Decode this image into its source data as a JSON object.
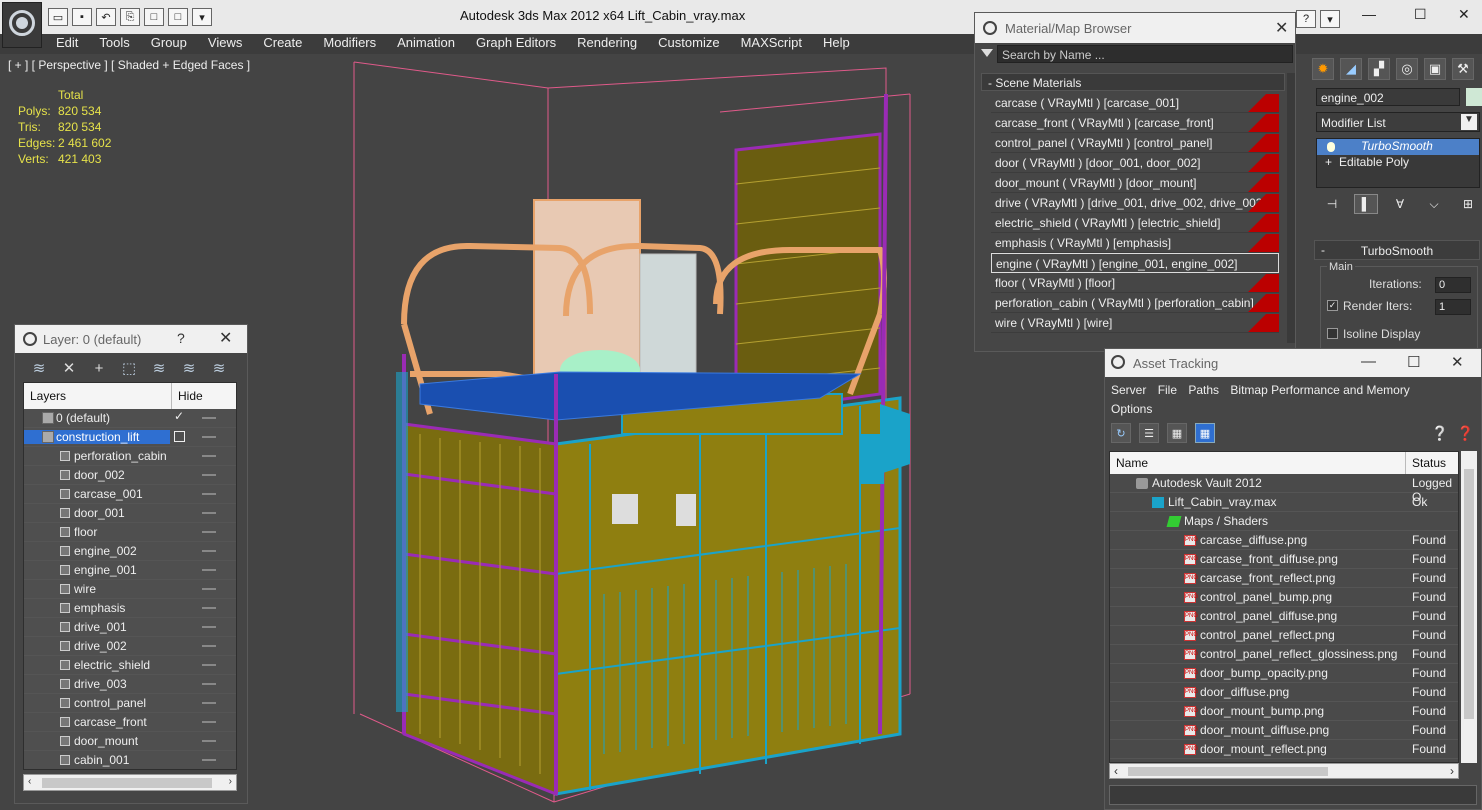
{
  "app": {
    "title": "Autodesk 3ds Max  2012 x64      Lift_Cabin_vray.max"
  },
  "menu": [
    "Edit",
    "Tools",
    "Group",
    "Views",
    "Create",
    "Modifiers",
    "Animation",
    "Graph Editors",
    "Rendering",
    "Customize",
    "MAXScript",
    "Help"
  ],
  "viewport": {
    "label": "[ + ] [ Perspective ] [ Shaded + Edged Faces ]",
    "stats": {
      "header": "Total",
      "rows": [
        {
          "k": "Polys:",
          "v": "820 534"
        },
        {
          "k": "Tris:",
          "v": "820 534"
        },
        {
          "k": "Edges:",
          "v": "2 461 602"
        },
        {
          "k": "Verts:",
          "v": "421 403"
        }
      ]
    }
  },
  "layer_panel": {
    "title": "Layer: 0 (default)",
    "help": "?",
    "col_layers": "Layers",
    "col_hide": "Hide",
    "rows": [
      {
        "name": "0 (default)",
        "level": 0
      },
      {
        "name": "construction_lift",
        "level": 0
      },
      {
        "name": "perforation_cabin",
        "level": 1
      },
      {
        "name": "door_002",
        "level": 1
      },
      {
        "name": "carcase_001",
        "level": 1
      },
      {
        "name": "door_001",
        "level": 1
      },
      {
        "name": "floor",
        "level": 1
      },
      {
        "name": "engine_002",
        "level": 1
      },
      {
        "name": "engine_001",
        "level": 1
      },
      {
        "name": "wire",
        "level": 1
      },
      {
        "name": "emphasis",
        "level": 1
      },
      {
        "name": "drive_001",
        "level": 1
      },
      {
        "name": "drive_002",
        "level": 1
      },
      {
        "name": "electric_shield",
        "level": 1
      },
      {
        "name": "drive_003",
        "level": 1
      },
      {
        "name": "control_panel",
        "level": 1
      },
      {
        "name": "carcase_front",
        "level": 1
      },
      {
        "name": "door_mount",
        "level": 1
      },
      {
        "name": "cabin_001",
        "level": 1
      }
    ]
  },
  "material_browser": {
    "title": "Material/Map Browser",
    "search_placeholder": "Search by Name ...",
    "section": "- Scene Materials",
    "materials": [
      "carcase  ( VRayMtl ) [carcase_001]",
      "carcase_front  ( VRayMtl ) [carcase_front]",
      "control_panel  ( VRayMtl ) [control_panel]",
      "door  ( VRayMtl ) [door_001, door_002]",
      "door_mount  ( VRayMtl ) [door_mount]",
      "drive  ( VRayMtl ) [drive_001, drive_002, drive_003]",
      "electric_shield  ( VRayMtl ) [electric_shield]",
      "emphasis  ( VRayMtl ) [emphasis]",
      "engine  ( VRayMtl ) [engine_001, engine_002]",
      "floor  ( VRayMtl ) [floor]",
      "perforation_cabin  ( VRayMtl ) [perforation_cabin]",
      "wire  ( VRayMtl ) [wire]"
    ],
    "selected_index": 8
  },
  "command_panel": {
    "object_name": "engine_002",
    "modifier_list": "Modifier List",
    "stack": [
      "TurboSmooth",
      "Editable Poly"
    ],
    "rollout": "TurboSmooth",
    "main_label": "Main",
    "iterations_label": "Iterations:",
    "iterations_value": "0",
    "render_iters_label": "Render Iters:",
    "render_iters_value": "1",
    "isoline_label": "Isoline Display"
  },
  "asset_tracking": {
    "title": "Asset Tracking",
    "menu": [
      "Server",
      "File",
      "Paths",
      "Bitmap Performance and Memory",
      "Options"
    ],
    "col_name": "Name",
    "col_status": "Status",
    "rows": [
      {
        "name": "Autodesk Vault 2012",
        "status": "Logged O",
        "indent": 1,
        "icon": "vault-icon"
      },
      {
        "name": "Lift_Cabin_vray.max",
        "status": "Ok",
        "indent": 2,
        "icon": "max-file-icon"
      },
      {
        "name": "Maps / Shaders",
        "status": "",
        "indent": 3,
        "icon": "maps-folder-icon"
      },
      {
        "name": "carcase_diffuse.png",
        "status": "Found",
        "indent": 4,
        "icon": "png-icon"
      },
      {
        "name": "carcase_front_diffuse.png",
        "status": "Found",
        "indent": 4,
        "icon": "png-icon"
      },
      {
        "name": "carcase_front_reflect.png",
        "status": "Found",
        "indent": 4,
        "icon": "png-icon"
      },
      {
        "name": "control_panel_bump.png",
        "status": "Found",
        "indent": 4,
        "icon": "png-icon"
      },
      {
        "name": "control_panel_diffuse.png",
        "status": "Found",
        "indent": 4,
        "icon": "png-icon"
      },
      {
        "name": "control_panel_reflect.png",
        "status": "Found",
        "indent": 4,
        "icon": "png-icon"
      },
      {
        "name": "control_panel_reflect_glossiness.png",
        "status": "Found",
        "indent": 4,
        "icon": "png-icon"
      },
      {
        "name": "door_bump_opacity.png",
        "status": "Found",
        "indent": 4,
        "icon": "png-icon"
      },
      {
        "name": "door_diffuse.png",
        "status": "Found",
        "indent": 4,
        "icon": "png-icon"
      },
      {
        "name": "door_mount_bump.png",
        "status": "Found",
        "indent": 4,
        "icon": "png-icon"
      },
      {
        "name": "door_mount_diffuse.png",
        "status": "Found",
        "indent": 4,
        "icon": "png-icon"
      },
      {
        "name": "door_mount_reflect.png",
        "status": "Found",
        "indent": 4,
        "icon": "png-icon"
      }
    ]
  },
  "colors": {
    "selection_blue": "#2f6fd1",
    "stats_yellow": "#e6e24a",
    "material_red": "#b00000",
    "wire_cyan": "#1aa3c9",
    "wire_magenta": "#9a2bb5",
    "wire_orange": "#e8a36a",
    "wire_olive": "#8f7f10"
  }
}
